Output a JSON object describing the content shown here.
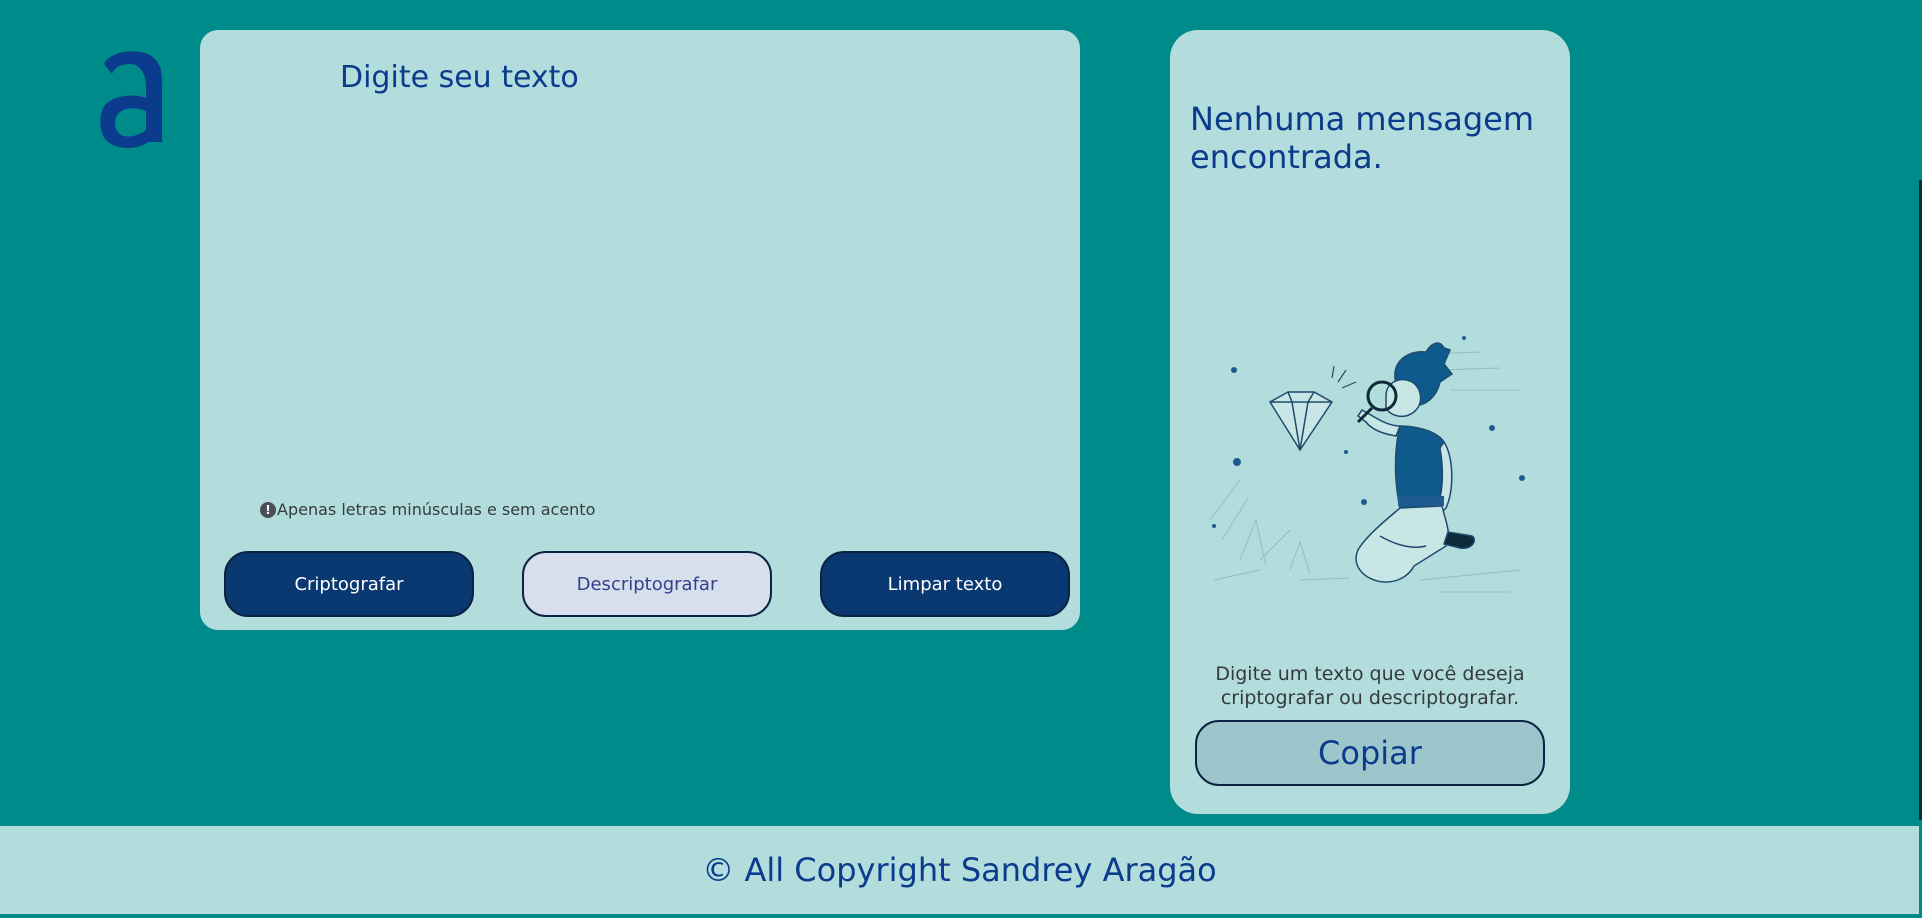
{
  "logo": {
    "letter": "a",
    "icon": "alura-logo-icon"
  },
  "input_panel": {
    "placeholder": "Digite seu texto",
    "hint_icon": "exclamation-circle-icon",
    "hint_text": "Apenas letras minúsculas e sem acento",
    "buttons": {
      "encrypt": "Criptografar",
      "decrypt": "Descriptografar",
      "clear": "Limpar texto"
    }
  },
  "output_panel": {
    "title": "Nenhuma mensagem encontrada.",
    "illustration": "person-with-magnifying-glass-examining-diamond",
    "instruction": "Digite um texto que você deseja criptografar ou descriptografar.",
    "copy_button": "Copiar"
  },
  "footer": {
    "text": "© All Copyright Sandrey Aragão"
  },
  "colors": {
    "page_background": "#008b8b",
    "panel_background": "#b3dddd",
    "primary_button": "#0a3971",
    "secondary_button": "#d8dfec",
    "copy_button": "#9cc6cc",
    "text_blue": "#0a3b8c"
  }
}
